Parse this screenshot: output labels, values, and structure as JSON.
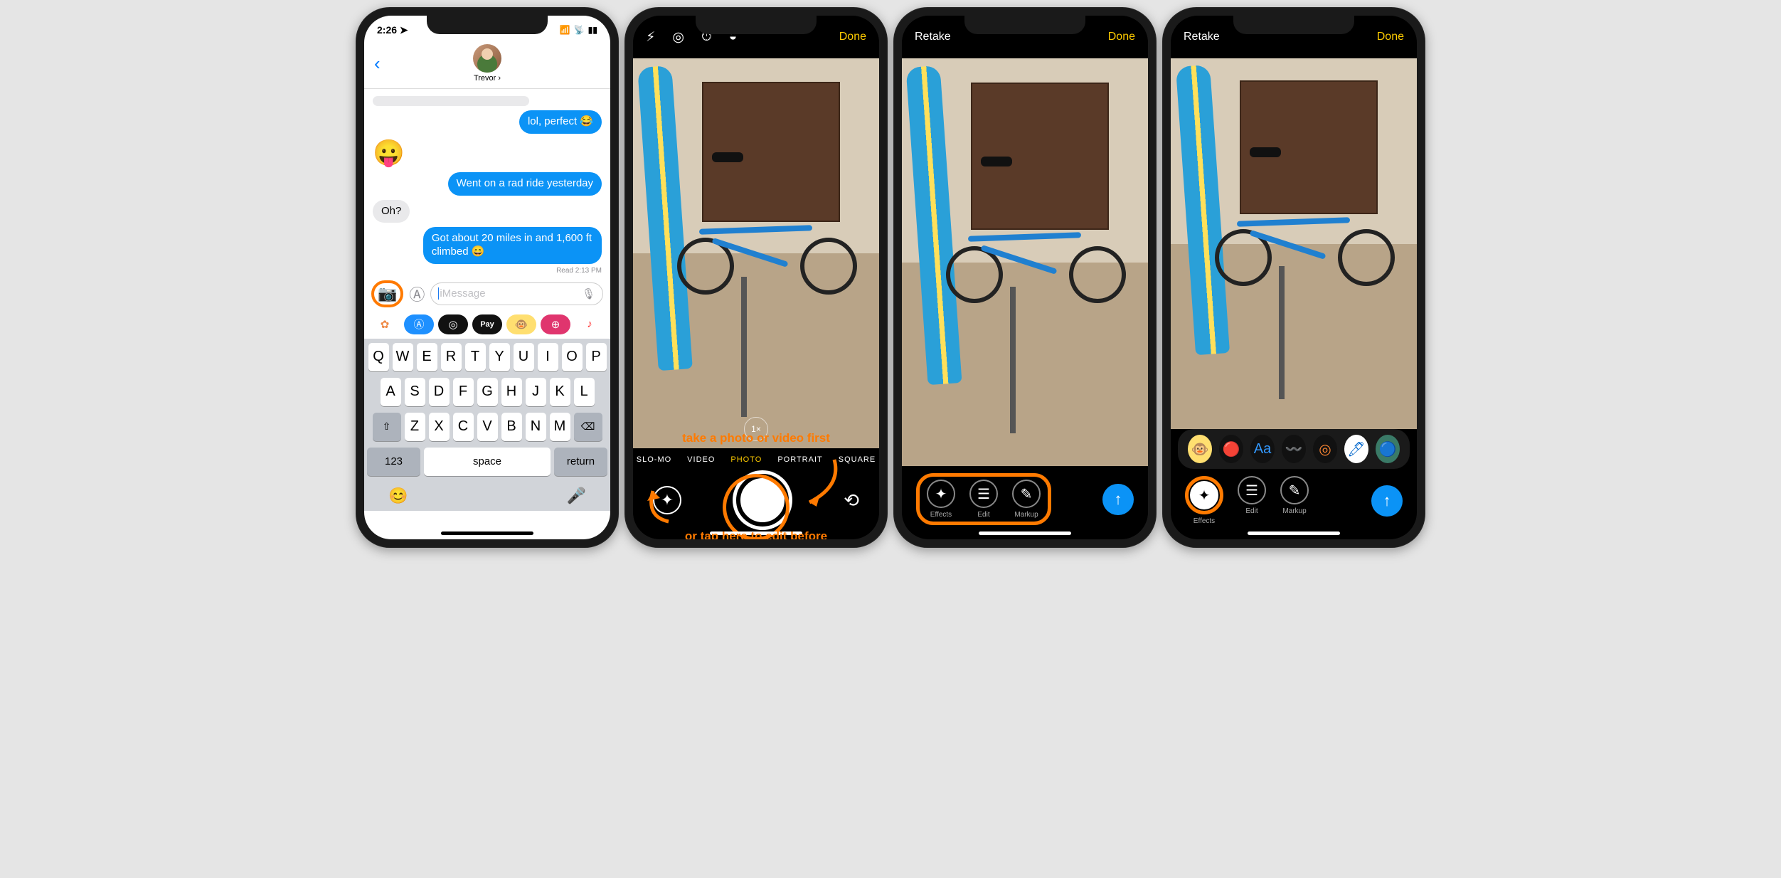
{
  "status": {
    "time": "2:26",
    "loc": "➤"
  },
  "contact_name": "Trevor ›",
  "messages": {
    "m1": "lol, perfect 😂",
    "m2": "😛",
    "m3": "Went on a rad ride yesterday",
    "m4": "Oh?",
    "m5": "Got about 20 miles in and 1,600 ft climbed 😄",
    "read": "Read 2:13 PM"
  },
  "input": {
    "placeholder": "iMessage"
  },
  "keyboard": {
    "space": "space",
    "return": "return",
    "num": "123"
  },
  "camera": {
    "done": "Done",
    "retake": "Retake",
    "modes": {
      "slomo": "SLO-MO",
      "video": "VIDEO",
      "photo": "PHOTO",
      "portrait": "PORTRAIT",
      "square": "SQUARE"
    },
    "zoom": "1×"
  },
  "annotations": {
    "top": "take a photo or video first",
    "bottom": "or tap here to edit before"
  },
  "tools": {
    "effects": "Effects",
    "edit": "Edit",
    "markup": "Markup"
  },
  "effects_icons": [
    "🐵",
    "🔴",
    "Aa",
    "〰️",
    "◎",
    "🖊",
    "🔵"
  ]
}
